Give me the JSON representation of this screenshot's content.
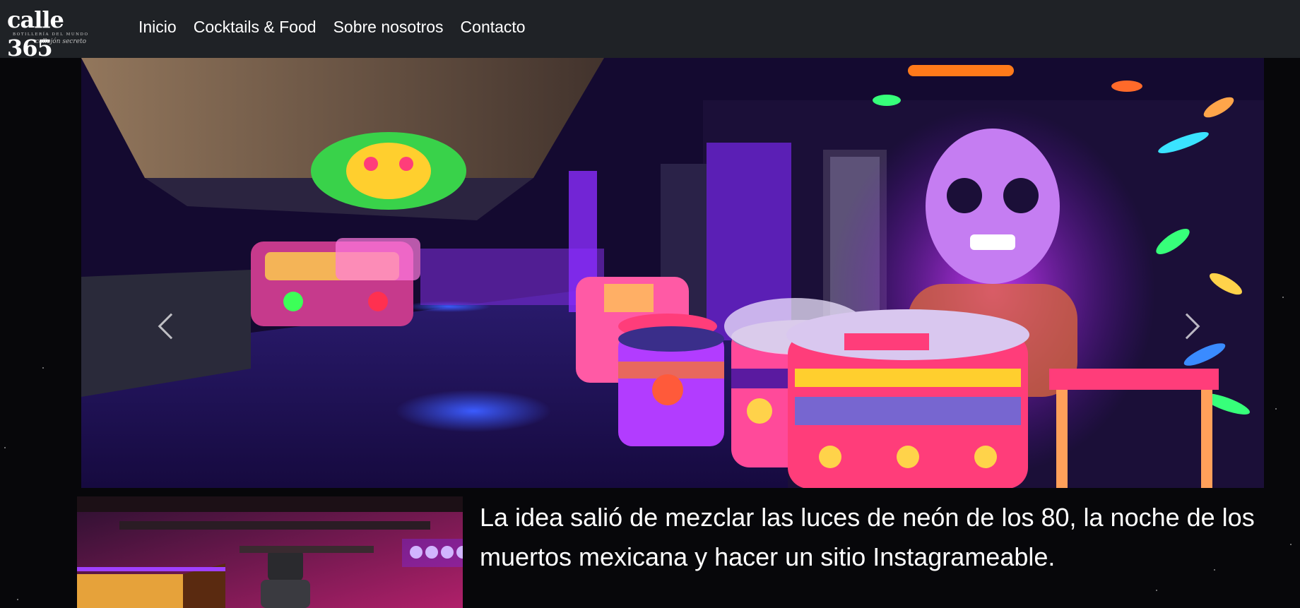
{
  "brand": {
    "name": "calle 365",
    "tagline": "BOTILLERÍA DEL MUNDO",
    "script": "callejón secreto"
  },
  "nav": {
    "items": [
      {
        "label": "Inicio"
      },
      {
        "label": "Cocktails & Food"
      },
      {
        "label": "Sobre nosotros"
      },
      {
        "label": "Contacto"
      }
    ]
  },
  "hero": {
    "image": "neon-bar-interior",
    "prev_icon": "chevron-left-icon",
    "next_icon": "chevron-right-icon"
  },
  "intro": {
    "text": "La idea salió de mezclar las luces de neón de los 80, la noche de los muertos mexicana y hacer un sitio Instagrameable."
  },
  "colors": {
    "navbar": "#1f2226",
    "background": "#07070a",
    "text": "#ffffff"
  }
}
